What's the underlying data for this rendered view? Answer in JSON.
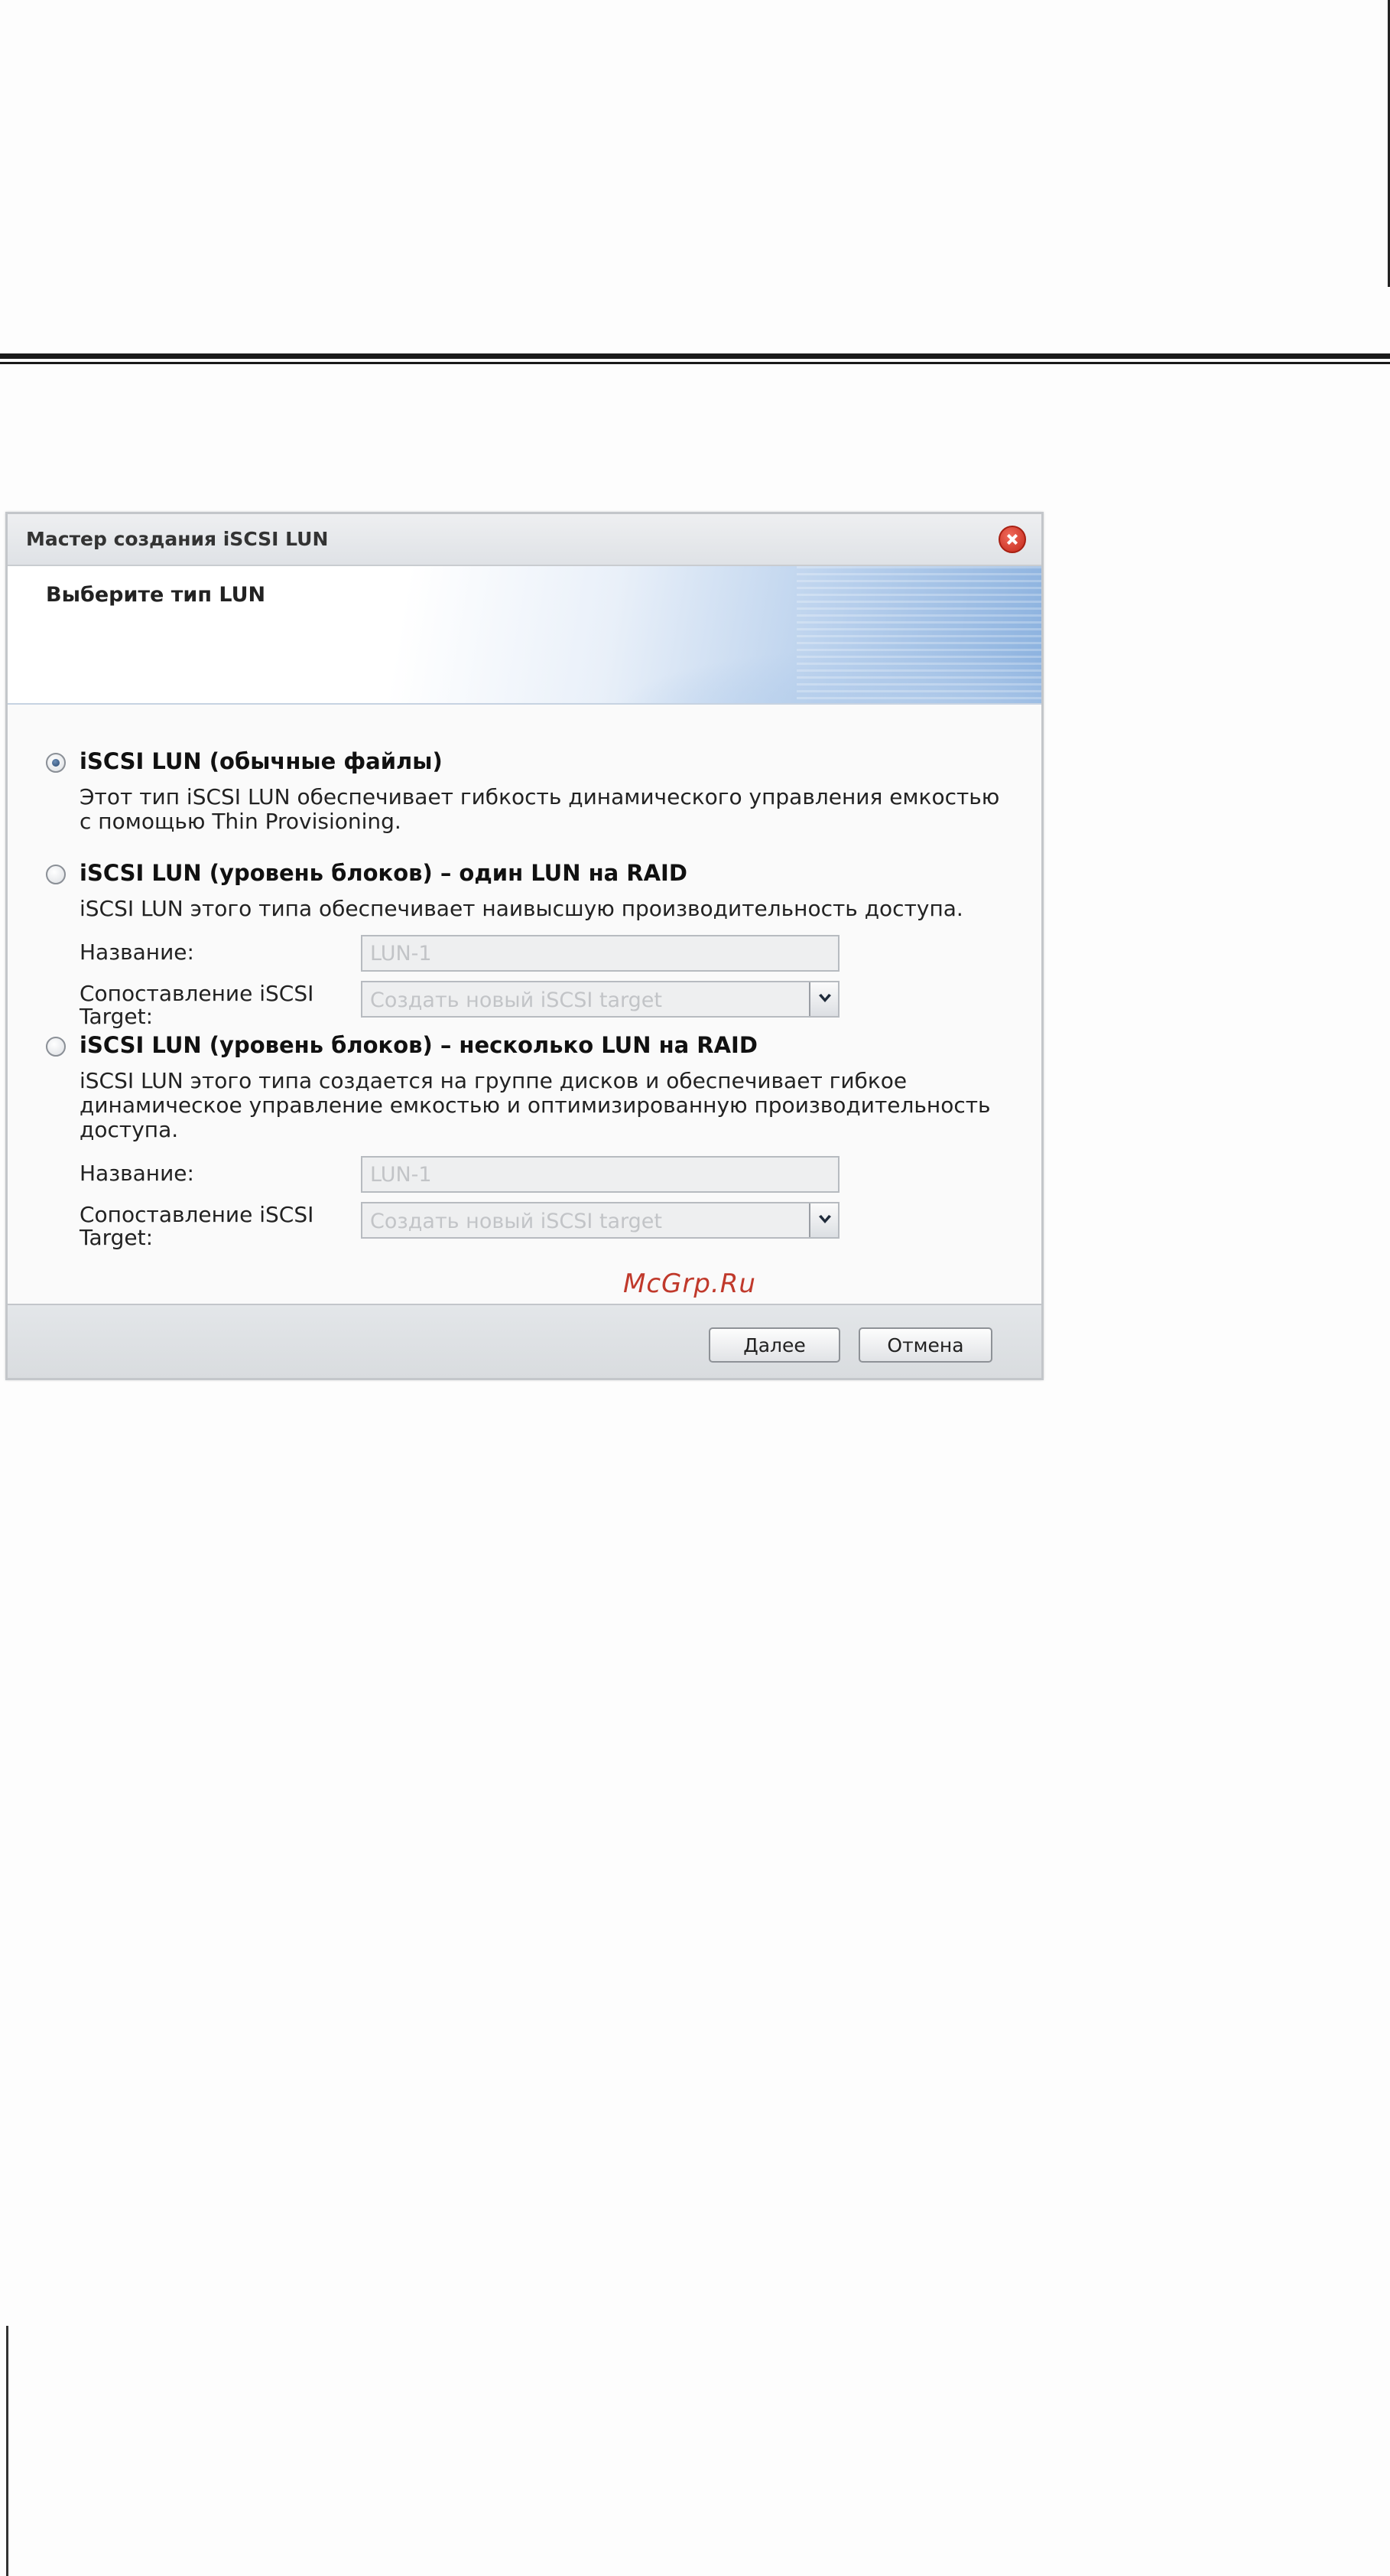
{
  "dialog": {
    "title": "Мастер создания iSCSI LUN",
    "header": "Выберите тип LUN",
    "options": [
      {
        "title": "iSCSI LUN (обычные файлы)",
        "selected": true,
        "desc_lines": [
          "Этот тип iSCSI LUN обеспечивает гибкость динамического управления емкостью",
          "с помощью Thin Provisioning."
        ]
      },
      {
        "title": "iSCSI LUN (уровень блоков) – один LUN на RAID",
        "selected": false,
        "desc_lines": [
          "iSCSI LUN этого типа обеспечивает наивысшую производительность доступа."
        ],
        "name_label": "Название:",
        "name_value": "LUN-1",
        "target_label_lines": [
          "Сопоставление iSCSI",
          "Target:"
        ],
        "target_value": "Создать новый iSCSI target"
      },
      {
        "title": "iSCSI LUN (уровень блоков) – несколько LUN на RAID",
        "selected": false,
        "desc_lines": [
          "iSCSI LUN этого типа создается на группе дисков и обеспечивает гибкое",
          "динамическое управление емкостью и оптимизированную производительность",
          "доступа."
        ],
        "name_label": "Название:",
        "name_value": "LUN-1",
        "target_label_lines": [
          "Сопоставление iSCSI",
          "Target:"
        ],
        "target_value": "Создать новый iSCSI target"
      }
    ],
    "buttons": {
      "next": "Далее",
      "cancel": "Отмена"
    }
  },
  "watermark": "McGrp.Ru"
}
